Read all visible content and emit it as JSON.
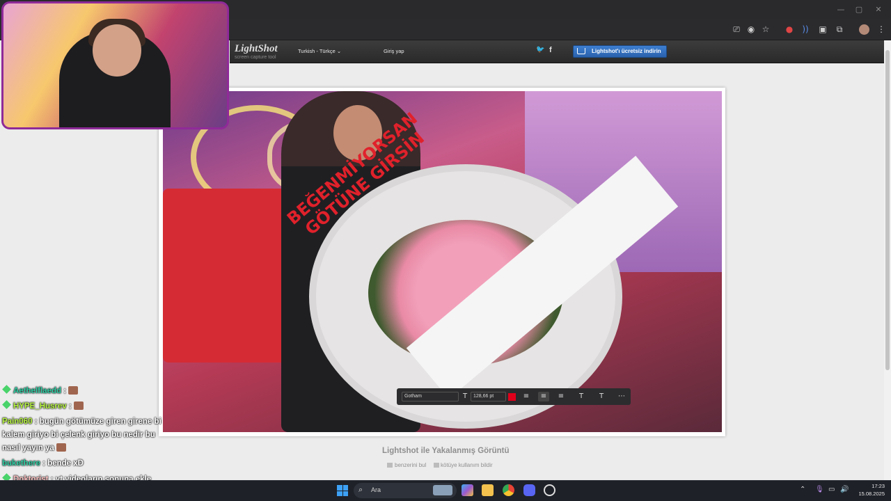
{
  "window_controls": [
    "—",
    "▢",
    "✕"
  ],
  "browser_toolbar_icons": [
    "screen-cast-icon",
    "eye-off-icon",
    "star-icon",
    "extension-badge-icon",
    "sound-wave-icon",
    "cube-extension-icon",
    "puzzle-icon",
    "avatar",
    "menu-icon"
  ],
  "lightshot": {
    "logo": "LightShot",
    "logo_sub": "screen capture tool",
    "language": "Turkish - Türkçe",
    "login": "Giriş yap",
    "twitter": "🐦",
    "facebook": "f",
    "download_button": "Lightshot'ı ücretsiz indirin",
    "caption": "Lightshot ile Yakalanmış Görüntü",
    "find_similar": "benzerini bul",
    "report": "kötüye kullanım bildir"
  },
  "screenshot": {
    "banner_text_line1": "BEĞENMİYORSAN",
    "banner_text_line2": "GÖTÜNE GİRSİN",
    "font_toolbar": {
      "font_name": "Gotham",
      "font_size": "128,66 pt",
      "color": "#e0001b"
    }
  },
  "chat": [
    {
      "user": "Aethelflaedd",
      "message": ":",
      "badge": true,
      "emote": true
    },
    {
      "user": "HYPE_Husrev",
      "message": ":",
      "badge": true,
      "emote": true
    },
    {
      "user": "Pain060",
      "message": ": bugün götümüze giren girene bi kalem giriyo bi çelenk giriyo bu nedir bu nasıl yayın ya",
      "badge": false,
      "emote": true
    },
    {
      "user": "bukethere",
      "message": ": bende xD",
      "badge": false,
      "emote": false
    },
    {
      "user": "Doktorist",
      "message": ": yt videoların sonuna ekle bunu yaman",
      "badge": true,
      "emote": false
    }
  ],
  "taskbar": {
    "search_placeholder": "Ara",
    "time": "17:23",
    "date": "15.08.2025"
  }
}
